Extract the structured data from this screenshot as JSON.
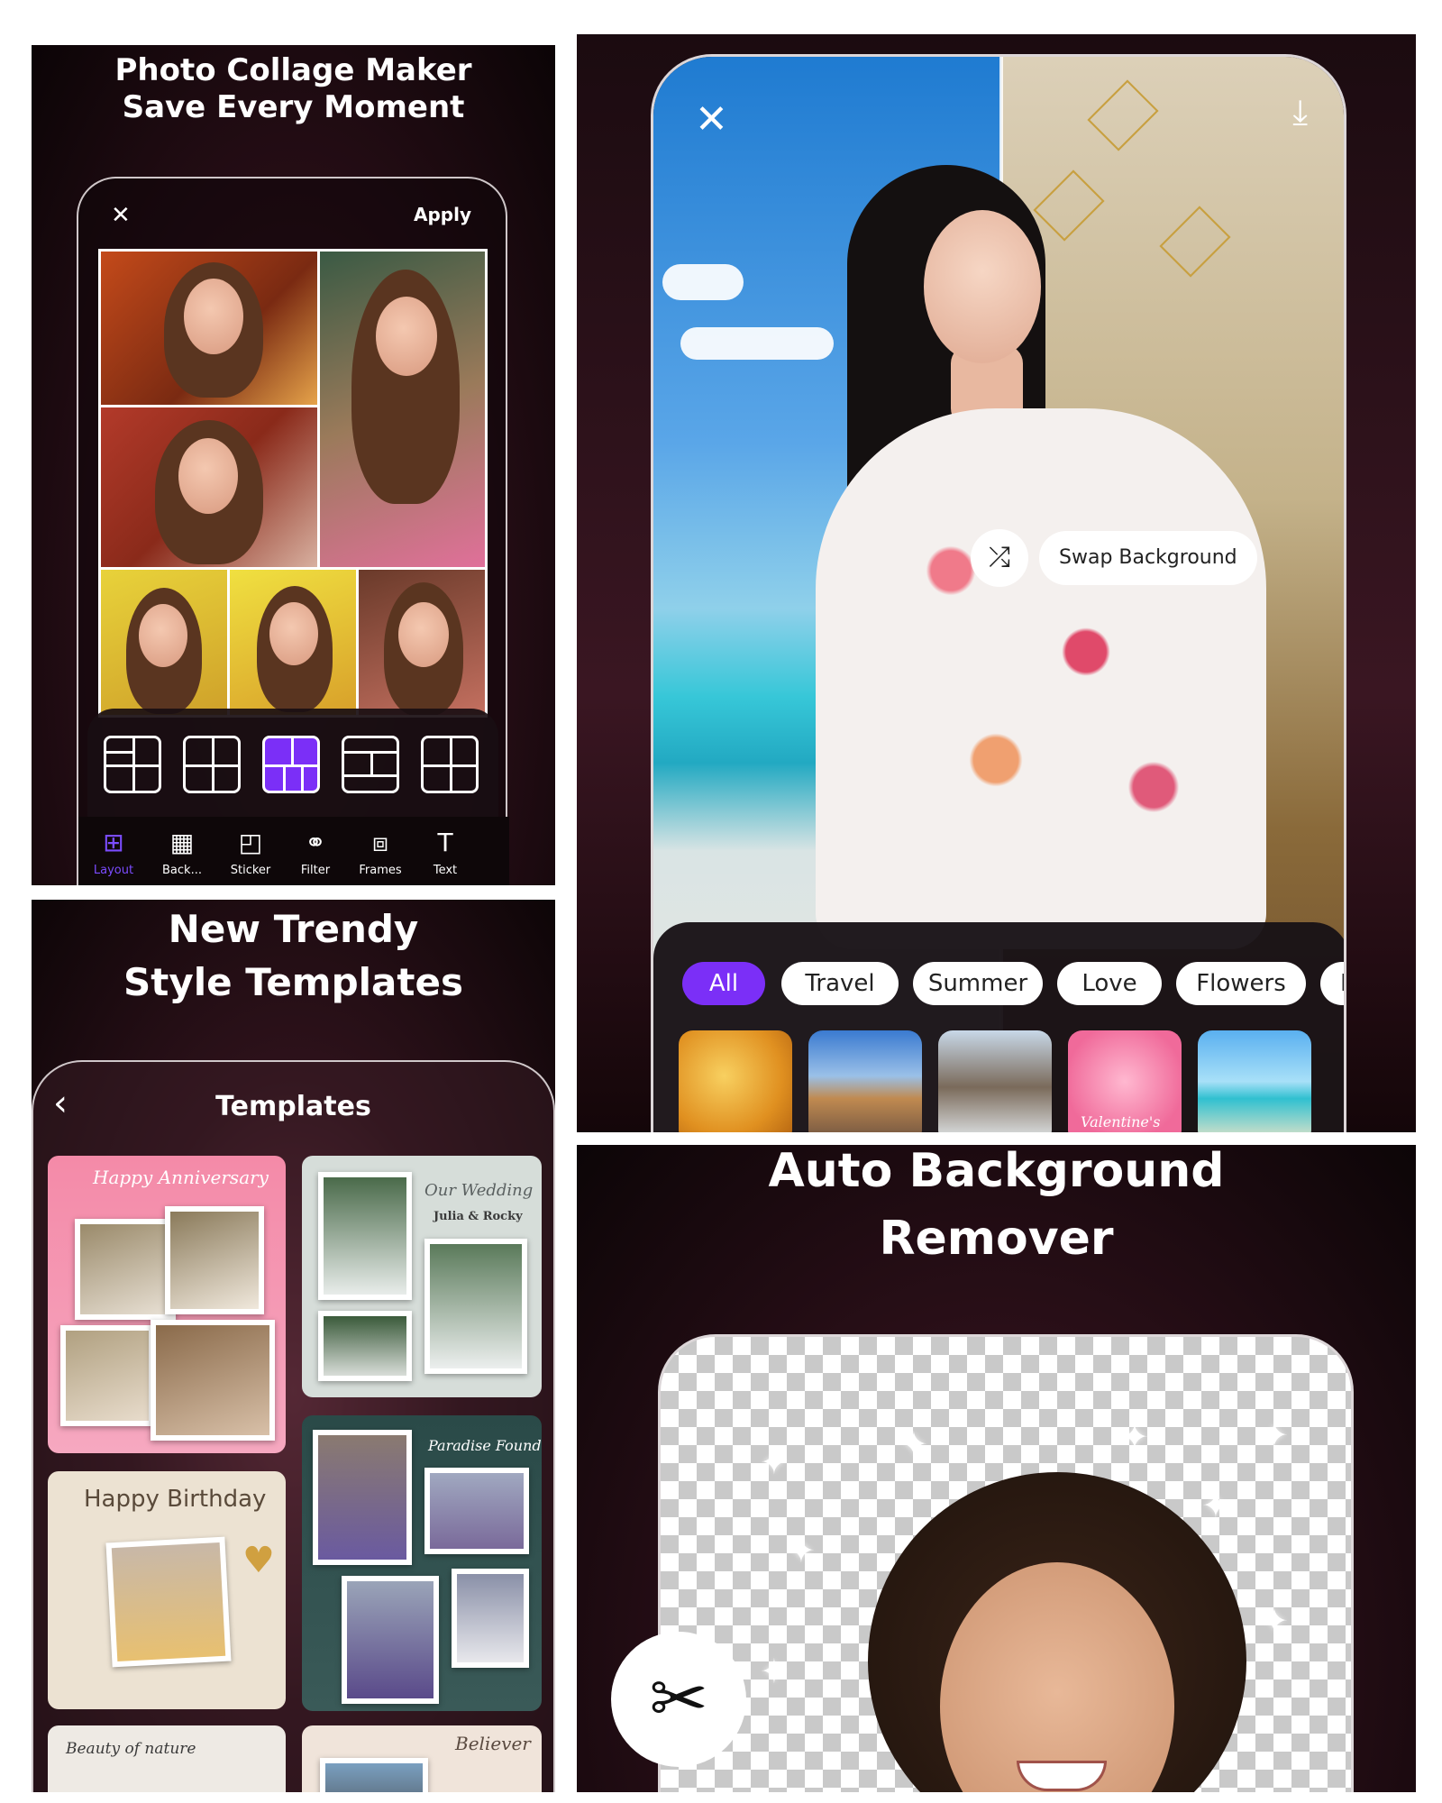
{
  "panel1": {
    "headline": [
      "Photo Collage Maker",
      "Save Every Moment"
    ],
    "close_icon": "✕",
    "apply_label": "Apply",
    "toolbar": [
      {
        "icon": "layout-icon",
        "glyph": "⊞",
        "label": "Layout",
        "active": true
      },
      {
        "icon": "background-icon",
        "glyph": "▦",
        "label": "Back...",
        "active": false
      },
      {
        "icon": "sticker-icon",
        "glyph": "◰",
        "label": "Sticker",
        "active": false
      },
      {
        "icon": "filter-icon",
        "glyph": "⚭",
        "label": "Filter",
        "active": false
      },
      {
        "icon": "frames-icon",
        "glyph": "⧈",
        "label": "Frames",
        "active": false
      },
      {
        "icon": "text-icon",
        "glyph": "T",
        "label": "Text",
        "active": false
      }
    ],
    "selected_layout": 3
  },
  "panel2": {
    "close_icon": "✕",
    "download_icon": "⤓",
    "shuffle_icon": "⤮",
    "swap_label": "Swap Background",
    "categories": [
      "All",
      "Travel",
      "Summer",
      "Love",
      "Flowers",
      "H"
    ],
    "selected_category": "All",
    "valentine_text": "Valentine's"
  },
  "panel3": {
    "headline": [
      "New Trendy",
      "Style Templates"
    ],
    "back_icon": "‹",
    "title": "Templates",
    "templates": {
      "anniversary": "Happy Anniversary",
      "wedding": "Our Wedding",
      "wedding_names": "Julia & Rocky",
      "paradise": "Paradise Found",
      "birthday": "Happy Birthday",
      "nature": "Beauty of nature",
      "believer": "Believer"
    }
  },
  "panel4": {
    "headline": [
      "Auto Background",
      "Remover"
    ],
    "scissors_icon": "✂"
  },
  "colors": {
    "accent_purple": "#7b2ff7",
    "white": "#ffffff"
  }
}
